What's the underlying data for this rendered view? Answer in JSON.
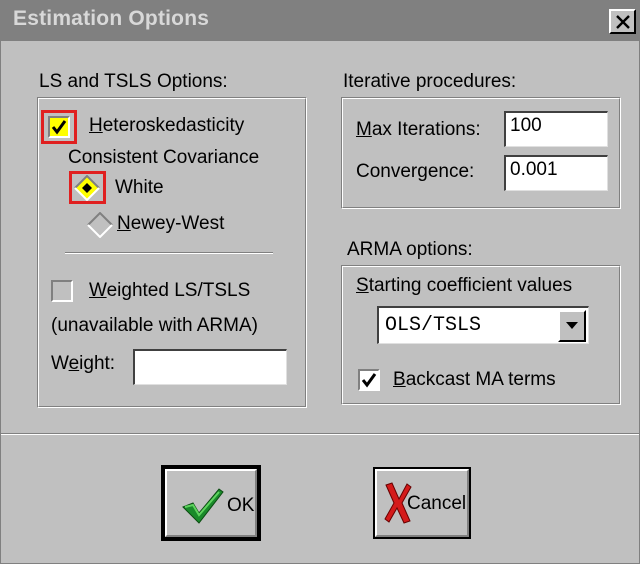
{
  "dialog": {
    "title": "Estimation Options"
  },
  "ls_group": {
    "label": "LS and TSLS Options:",
    "hetero": {
      "checked": true,
      "label_line1": "Heteroskedasticity",
      "label_line2": "Consistent Covariance"
    },
    "covariance_options": [
      {
        "label": "White",
        "selected": true
      },
      {
        "label": "Newey-West",
        "selected": false
      }
    ],
    "weighted": {
      "checked": false,
      "label": "Weighted LS/TSLS",
      "note": "(unavailable with ARMA)",
      "weight_label": "Weight:",
      "weight_value": ""
    }
  },
  "iter_group": {
    "label": "Iterative procedures:",
    "max_iter_label": "Max Iterations:",
    "max_iter_value": "100",
    "convergence_label": "Convergence:",
    "convergence_value": "0.001"
  },
  "arma_group": {
    "label": "ARMA options:",
    "starting_label": "Starting coefficient values",
    "starting_value": "OLS/TSLS",
    "backcast": {
      "checked": true,
      "label": "Backcast MA terms"
    }
  },
  "buttons": {
    "ok_label": "OK",
    "cancel_label": "Cancel"
  },
  "colors": {
    "highlight": "#e02020",
    "dialog_bg": "#c0c0c0",
    "titlebar_bg": "#808080"
  }
}
